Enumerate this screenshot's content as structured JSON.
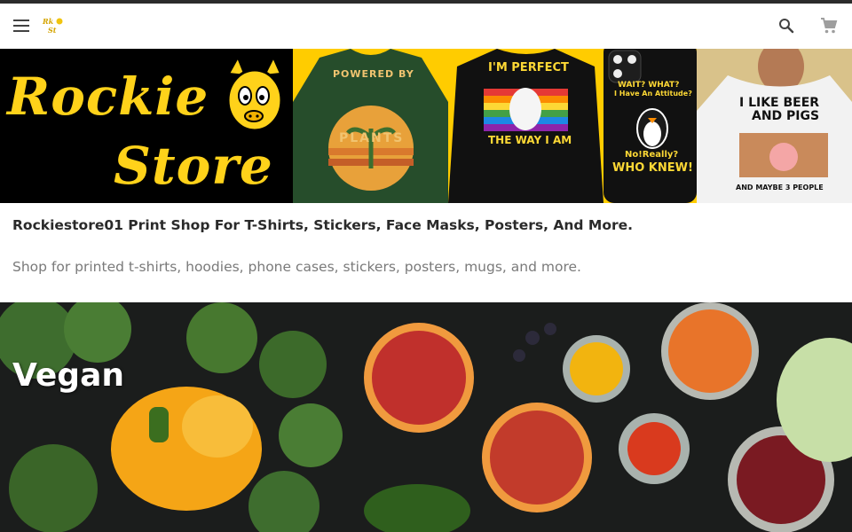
{
  "colors": {
    "top_line": "#2b2b2b",
    "brand_yellow": "#ffd21a",
    "title_text": "#2a2a2a",
    "desc_text": "#7a7a7a",
    "icon": "#424242"
  },
  "header": {
    "menu_icon": "menu-icon",
    "logo_icon": "rockie-store-logo",
    "search_icon": "search-icon",
    "cart_icon": "shopping-cart-icon"
  },
  "banner": {
    "brand_line1": "Rockie",
    "brand_line2": "Store",
    "products": {
      "green_shirt": {
        "line1": "POWERED BY",
        "line2": "PLANTS"
      },
      "black_shirt": {
        "line1": "I'M PERFECT",
        "line2": "THE WAY I AM"
      },
      "phone_case": {
        "line1": "WAIT? WHAT?",
        "line2": "I Have An Attitude?",
        "line3": "No!Really?",
        "line4": "WHO KNEW!"
      },
      "hoodie": {
        "line1": "I LIKE BEER",
        "line2": "AND PIGS",
        "line3": "AND MAYBE 3 PEOPLE"
      }
    }
  },
  "shop": {
    "title": "Rockiestore01 Print Shop For T-Shirts, Stickers, Face Masks, Posters, And More.",
    "description": "Shop for printed t-shirts, hoodies, phone cases, stickers, posters, mugs, and more."
  },
  "collection": {
    "title": "Vegan"
  }
}
